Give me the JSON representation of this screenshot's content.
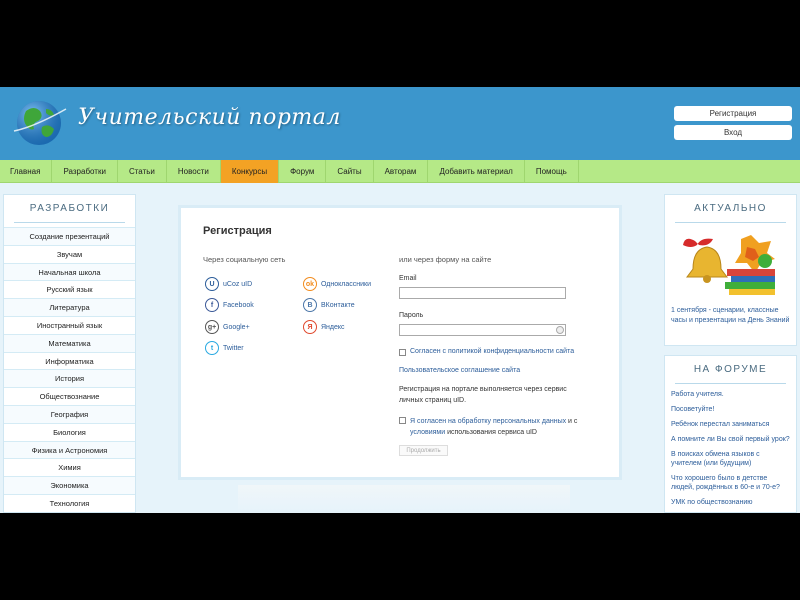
{
  "header": {
    "site_title": "Учительский портал",
    "register_label": "Регистрация",
    "login_label": "Вход"
  },
  "nav": {
    "items": [
      {
        "label": "Главная"
      },
      {
        "label": "Разработки"
      },
      {
        "label": "Статьи"
      },
      {
        "label": "Новости"
      },
      {
        "label": "Конкурсы"
      },
      {
        "label": "Форум"
      },
      {
        "label": "Сайты"
      },
      {
        "label": "Авторам"
      },
      {
        "label": "Добавить материал"
      },
      {
        "label": "Помощь"
      }
    ],
    "active_index": 4
  },
  "left_sidebar": {
    "title": "РАЗРАБОТКИ",
    "items": [
      "Создание презентаций",
      "Звучам",
      "Начальная школа",
      "Русский язык",
      "Литература",
      "Иностранный язык",
      "Математика",
      "Информатика",
      "История",
      "Обществознание",
      "География",
      "Биология",
      "Физика и Астрономия",
      "Химия",
      "Экономика",
      "Технология"
    ]
  },
  "registration": {
    "title": "Регистрация",
    "social_caption": "Через социальную сеть",
    "form_caption": "или через форму на сайте",
    "social": [
      {
        "label": "uCoz uID",
        "icon": "ucoz-icon",
        "glyph": "U",
        "color": "#2c5d9a"
      },
      {
        "label": "Одноклассники",
        "icon": "odnoklassniki-icon",
        "glyph": "ok",
        "color": "#f28c1e"
      },
      {
        "label": "Facebook",
        "icon": "facebook-icon",
        "glyph": "f",
        "color": "#3b5998"
      },
      {
        "label": "ВКонтакте",
        "icon": "vkontakte-icon",
        "glyph": "B",
        "color": "#4a76a8"
      },
      {
        "label": "Google+",
        "icon": "google-plus-icon",
        "glyph": "g+",
        "color": "#555555"
      },
      {
        "label": "Яндекс",
        "icon": "yandex-icon",
        "glyph": "Я",
        "color": "#e0492e"
      },
      {
        "label": "Twitter",
        "icon": "twitter-icon",
        "glyph": "t",
        "color": "#29a9e1"
      }
    ],
    "email_label": "Email",
    "password_label": "Пароль",
    "privacy_checkbox": "Согласен с политикой конфиденциальности сайта",
    "agreement_link": "Пользовательское соглашение сайта",
    "portal_note": "Регистрация на портале выполняется через сервис личных страниц uID.",
    "consent_part1": "Я согласен на обработку персональных данных",
    "consent_part2": " и с ",
    "consent_part3": "условиями",
    "consent_part4": " использования сервиса uID",
    "submit_label": "Продолжить"
  },
  "right_sidebar": {
    "actual_title": "АКТУАЛЬНО",
    "actual_text": "1 сентября - сценарии, классные часы и презентации на День Знаний",
    "forum_title": "НА ФОРУМЕ",
    "forum_items": [
      "Работа учителя.",
      "Посоветуйте!",
      "Ребёнок перестал заниматься",
      "А помните ли Вы свой первый урок?",
      "В поисках обмена языков с учителем (или будущим)",
      "Что хорошего было в детстве людей, рождённых в 60-е и 70-е?",
      "УМК по обществознанию"
    ]
  }
}
